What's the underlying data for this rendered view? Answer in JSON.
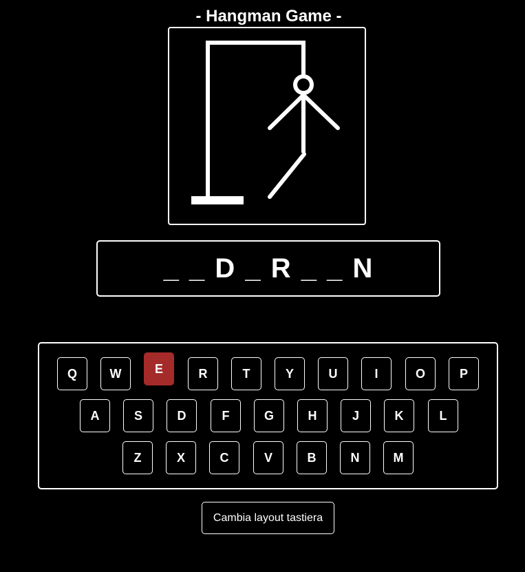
{
  "title": "- Hangman Game -",
  "word_display": "_ _ D _ R _ _ N",
  "keyboard": {
    "rows": [
      [
        "Q",
        "W",
        "E",
        "R",
        "T",
        "Y",
        "U",
        "I",
        "O",
        "P"
      ],
      [
        "A",
        "S",
        "D",
        "F",
        "G",
        "H",
        "J",
        "K",
        "L"
      ],
      [
        "Z",
        "X",
        "C",
        "V",
        "B",
        "N",
        "M"
      ]
    ],
    "used_letters": [
      "E"
    ],
    "used_color": "#a52a2a"
  },
  "layout_button_label": "Cambia layout tastiera",
  "hangman": {
    "parts_shown": [
      "base",
      "pole",
      "beam",
      "rope",
      "head",
      "body",
      "left-arm",
      "right-arm",
      "left-leg"
    ],
    "stroke_color": "#ffffff"
  }
}
